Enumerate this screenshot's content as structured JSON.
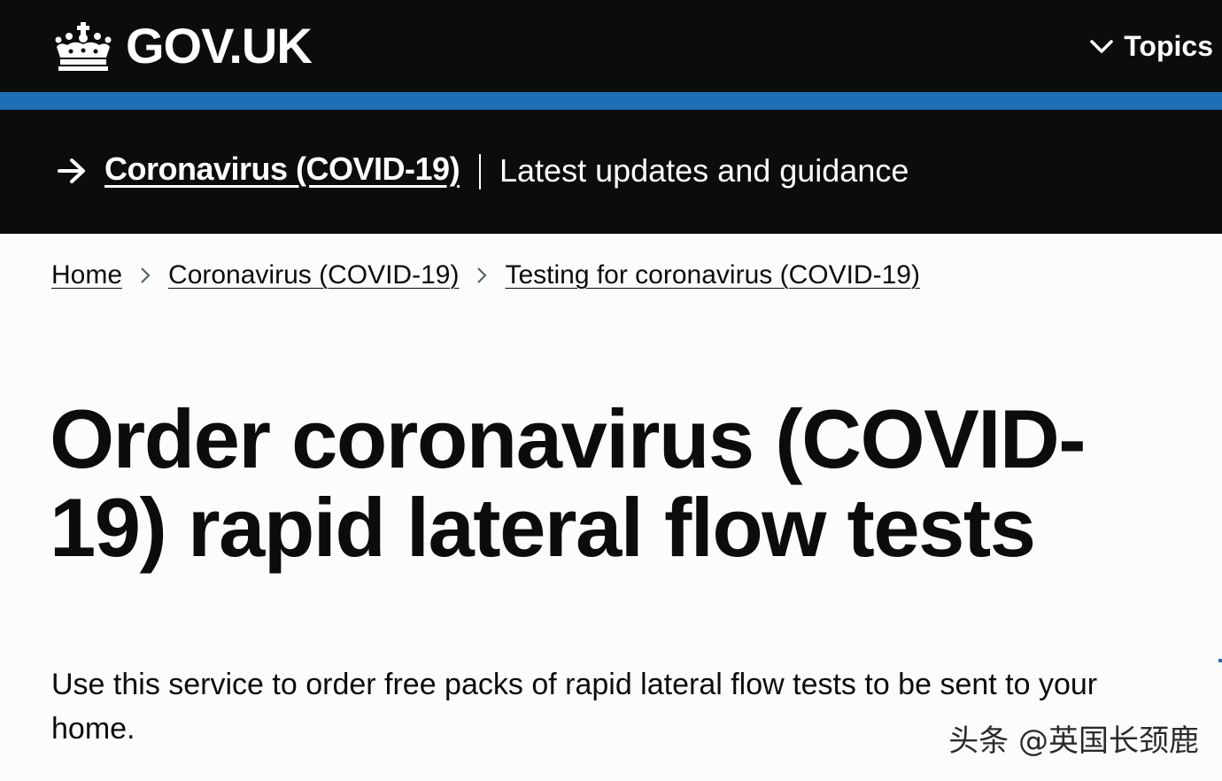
{
  "header": {
    "logo_text": "GOV.UK",
    "topics_label": "Topics"
  },
  "banner": {
    "link_text": "Coronavirus (COVID-19)",
    "description": "Latest updates and guidance"
  },
  "breadcrumbs": [
    {
      "label": "Home"
    },
    {
      "label": "Coronavirus (COVID-19)"
    },
    {
      "label": "Testing for coronavirus (COVID-19)"
    }
  ],
  "main": {
    "title": "Order coronavirus (COVID-19) rapid lateral flow tests",
    "lead": "Use this service to order free packs of rapid lateral flow tests to be sent to your home."
  },
  "watermark": "头条 @英国长颈鹿",
  "colors": {
    "header_bg": "#0b0c0c",
    "brand_blue": "#1d70b8",
    "text": "#0b0c0c",
    "page_bg": "#fcfcfd"
  }
}
